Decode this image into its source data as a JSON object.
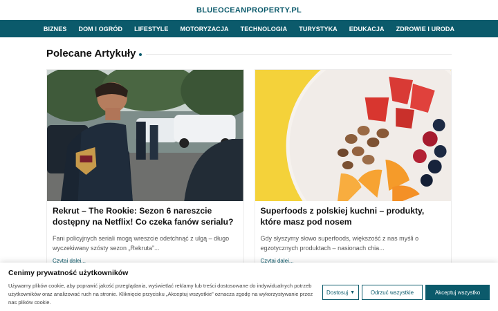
{
  "header": {
    "site_title": "BLUEOCEANPROPERTY.PL"
  },
  "nav": {
    "items": [
      "BIZNES",
      "DOM I OGRÓD",
      "LIFESTYLE",
      "MOTORYZACJA",
      "TECHNOLOGIA",
      "TURYSTYKA",
      "EDUKACJA",
      "ZDROWIE I URODA"
    ]
  },
  "section": {
    "title": "Polecane Artykuły"
  },
  "cards": [
    {
      "image": "police-officers-photo",
      "title": "Rekrut – The Rookie: Sezon 6 nareszcie dostępny na Netflix! Co czeka fanów serialu?",
      "excerpt": "Fani policyjnych seriali mogą wreszcie odetchnąć z ulgą – długo wyczekiwany szósty sezon „Rekruta”...",
      "more": "Czytaj dalej..."
    },
    {
      "image": "fruit-and-nuts-bowl-photo",
      "title": "Superfoods z polskiej kuchni – produkty, które masz pod nosem",
      "excerpt": "Gdy słyszymy słowo superfoods, większość z nas myśli o egzotycznych produktach – nasionach chia...",
      "more": "Czytaj dalej..."
    }
  ],
  "cookie": {
    "title": "Cenimy prywatność użytkowników",
    "text": "Używamy plików cookie, aby poprawić jakość przeglądania, wyświetlać reklamy lub treści dostosowane do indywidualnych potrzeb użytkowników oraz analizować ruch na stronie. Kliknięcie przycisku „Akceptuj wszystkie” oznacza zgodę na wykorzystywanie przez nas plików cookie.",
    "customize_label": "Dostosuj",
    "reject_label": "Odrzuć wszystkie",
    "accept_label": "Akceptuj wszystko"
  },
  "colors": {
    "brand": "#0b5a6b",
    "nav_text": "#ffffff"
  }
}
